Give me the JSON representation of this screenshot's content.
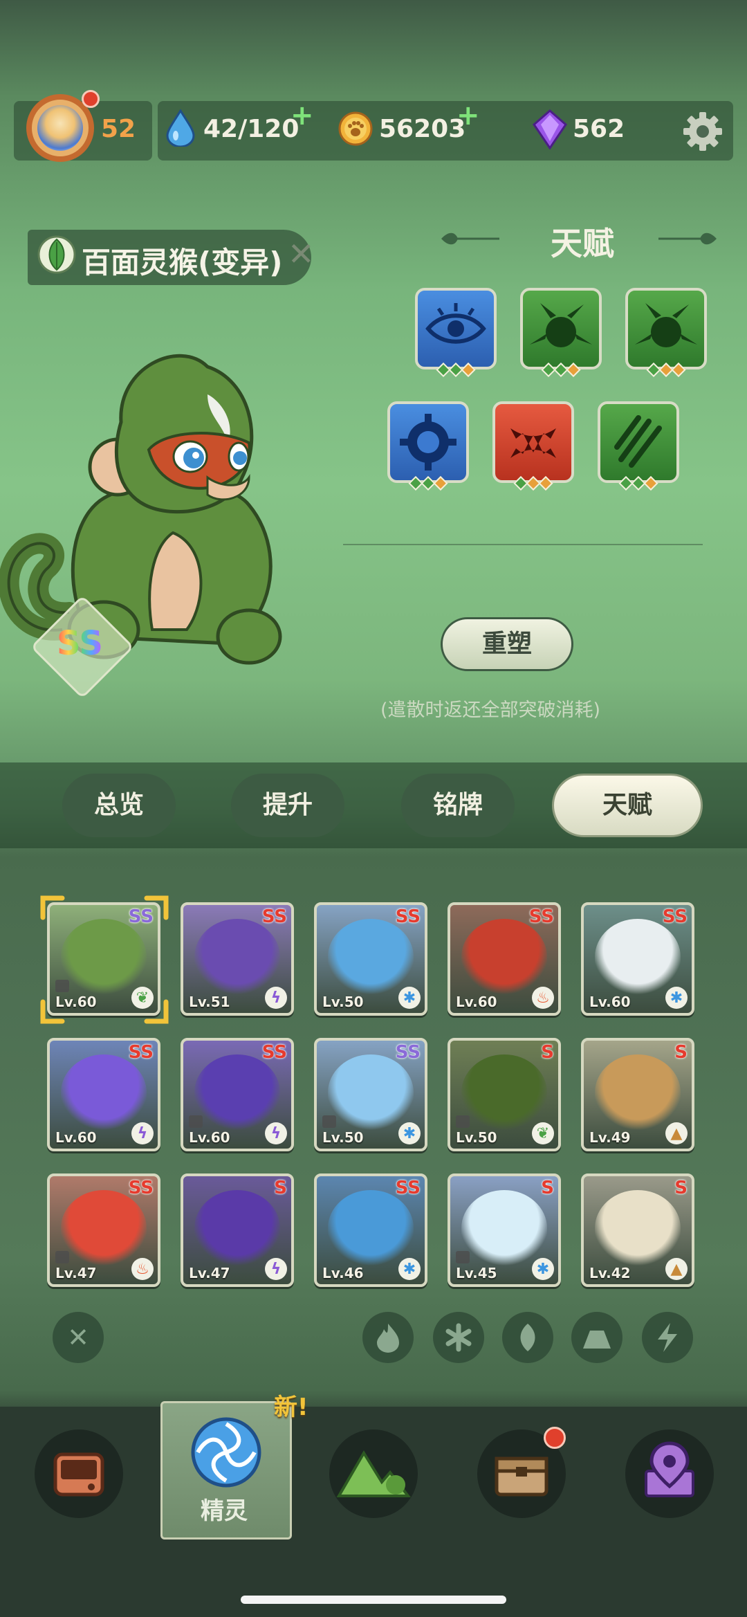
{
  "header": {
    "level": "52",
    "stamina": "42/120",
    "coins": "56203",
    "gems": "562",
    "plus": "+",
    "icons": [
      "avatar",
      "water-drop-icon",
      "paw-coin-icon",
      "purple-gem-icon",
      "gear-icon"
    ]
  },
  "pet": {
    "name": "百面灵猴(变异)",
    "element": "grass",
    "rank": "SS"
  },
  "talent": {
    "title": "天赋",
    "reshape_label": "重塑",
    "note": "(遣散时返还全部突破消耗)",
    "tiles": [
      {
        "icon": "eye-icon",
        "color": "#2f6fc2"
      },
      {
        "icon": "spiky-ball-icon",
        "color": "#3d8a3b"
      },
      {
        "icon": "spiky-ball-icon",
        "color": "#3d8a3b"
      },
      {
        "icon": "gear-ring-icon",
        "color": "#2f6fc2"
      },
      {
        "icon": "fangs-icon",
        "color": "#c83a2a"
      },
      {
        "icon": "claw-slash-icon",
        "color": "#3d8a3b"
      }
    ]
  },
  "tabs": [
    {
      "label": "总览",
      "active": false
    },
    {
      "label": "提升",
      "active": false
    },
    {
      "label": "铭牌",
      "active": false
    },
    {
      "label": "天赋",
      "active": true
    }
  ],
  "roster": [
    {
      "rank": "SS",
      "lv": "Lv.60",
      "element": "grass",
      "locked": true,
      "selected": true
    },
    {
      "rank": "SS",
      "lv": "Lv.51",
      "element": "electric",
      "locked": false
    },
    {
      "rank": "SS",
      "lv": "Lv.50",
      "element": "ice",
      "locked": false
    },
    {
      "rank": "SS",
      "lv": "Lv.60",
      "element": "fire",
      "locked": false
    },
    {
      "rank": "SS",
      "lv": "Lv.60",
      "element": "ice",
      "locked": false
    },
    {
      "rank": "SS",
      "lv": "Lv.60",
      "element": "electric",
      "locked": false
    },
    {
      "rank": "SS",
      "lv": "Lv.60",
      "element": "electric",
      "locked": true
    },
    {
      "rank": "SS",
      "lv": "Lv.50",
      "element": "ice",
      "locked": true
    },
    {
      "rank": "S",
      "lv": "Lv.50",
      "element": "grass",
      "locked": true
    },
    {
      "rank": "S",
      "lv": "Lv.49",
      "element": "earth",
      "locked": false
    },
    {
      "rank": "SS",
      "lv": "Lv.47",
      "element": "fire",
      "locked": true
    },
    {
      "rank": "S",
      "lv": "Lv.47",
      "element": "electric",
      "locked": false
    },
    {
      "rank": "SS",
      "lv": "Lv.46",
      "element": "ice",
      "locked": false
    },
    {
      "rank": "S",
      "lv": "Lv.45",
      "element": "ice",
      "locked": true
    },
    {
      "rank": "S",
      "lv": "Lv.42",
      "element": "earth",
      "locked": false
    }
  ],
  "filters": [
    "clear-filter-icon",
    "fire-icon",
    "ice-icon",
    "leaf-icon",
    "earth-icon",
    "lightning-icon"
  ],
  "nav": {
    "new_badge": "新!",
    "active_label": "精灵",
    "items": [
      "device-icon",
      "spirit-orb-icon",
      "mountain-icon",
      "chest-icon",
      "map-pin-icon"
    ]
  },
  "colors": {
    "fire": "#e8542c",
    "ice": "#3b95e0",
    "grass": "#4aa145",
    "electric": "#8a5ad6",
    "earth": "#c88a3a"
  }
}
